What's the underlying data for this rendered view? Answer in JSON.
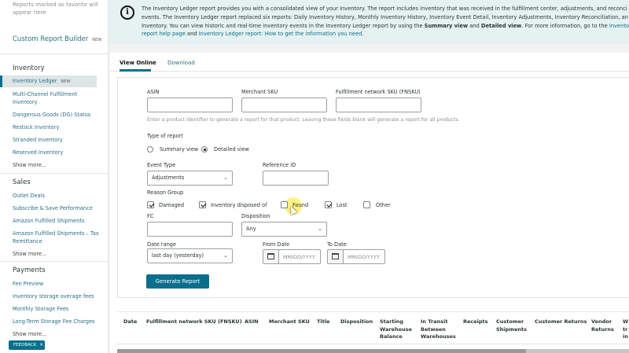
{
  "sidebar": {
    "favorites_hint": "Reports marked as favorite will appear here",
    "custom_builder": {
      "label": "Custom Report Builder",
      "tag": "NEW"
    },
    "inventory": {
      "heading": "Inventory",
      "items": [
        {
          "label": "Inventory Ledger",
          "tag": "NEW"
        },
        {
          "label": "Multi-Channel Fulfillment Inventory"
        },
        {
          "label": "Dangerous Goods (DG) Status"
        },
        {
          "label": "Restock Inventory"
        },
        {
          "label": "Stranded Inventory"
        },
        {
          "label": "Reserved Inventory"
        }
      ],
      "show_more": "Show more..."
    },
    "sales": {
      "heading": "Sales",
      "items": [
        {
          "label": "Outlet Deals"
        },
        {
          "label": "Subscribe & Save Performance"
        },
        {
          "label": "Amazon Fulfilled Shipments"
        },
        {
          "label": "Amazon Fulfilled Shipments – Tax Remittance"
        }
      ],
      "show_more": "Show more..."
    },
    "payments": {
      "heading": "Payments",
      "items": [
        {
          "label": "Fee Preview"
        },
        {
          "label": "Inventory storage overage fees"
        },
        {
          "label": "Monthly Storage Fees"
        },
        {
          "label": "Long-Term Storage Fee Charges"
        }
      ],
      "show_more": "Show more..."
    },
    "feedback": {
      "label": "FEEDBACK",
      "close": "×"
    }
  },
  "banner": {
    "line1": "The Inventory Ledger report provides you with a consolidated view of your inventory. The report includes inventory that was received in the fulfillment center, adjustments, and reconci",
    "line2": "events. The Inventory Ledger report replaced six reports: Daily Inventory History, Monthly Inventory History, Inventory Event Detail, Inventory Adjustments, Inventory Reconciliation, an",
    "line3_a": "Inventory. You can view historic and real-time inventory events in the Inventory Ledger report by using the ",
    "line3_b": "Summary view",
    "line3_c": " and ",
    "line3_d": "Detailed view",
    "line3_e": ". For more information, go to the ",
    "line3_f": "Inventory",
    "line4_a": "report help page",
    "line4_b": " and ",
    "line4_c": "Inventory Ledger report: How to get the information you need",
    "line4_d": "."
  },
  "tabs": [
    {
      "label": "View Online",
      "active": true
    },
    {
      "label": "Download",
      "active": false
    }
  ],
  "form": {
    "asin_label": "ASIN",
    "asin_value": "",
    "sku_label": "Merchant SKU",
    "sku_value": "",
    "fnsku_label": "Fulfillment network SKU (FNSKU)",
    "fnsku_value": "",
    "identifier_hint": "Enter a product identifier to generate a report for that product. Leaving these fields blank will generate a report for all products.",
    "report_type_label": "Type of report",
    "report_types": [
      {
        "label": "Summary view",
        "selected": false
      },
      {
        "label": "Detailed view",
        "selected": true
      }
    ],
    "event_type_label": "Event Type",
    "event_type_value": "Adjustments",
    "reference_id_label": "Reference ID",
    "reference_id_value": "",
    "reason_group_label": "Reason Group",
    "reasons": [
      {
        "label": "Damaged",
        "checked": true
      },
      {
        "label": "Inventory disposed of",
        "checked": true
      },
      {
        "label": "Found",
        "checked": false
      },
      {
        "label": "Lost",
        "checked": true
      },
      {
        "label": "Other",
        "checked": false
      }
    ],
    "fc_label": "FC",
    "fc_value": "",
    "disposition_label": "Disposition",
    "disposition_value": "Any",
    "date_range_label": "Date range",
    "date_range_value": "last day (yesterday)",
    "from_date_label": "From Date",
    "from_date_placeholder": "MM/DD/YYYY",
    "to_date_label": "To Date",
    "to_date_placeholder": "MM/DD/YYYY",
    "generate_label": "Generate Report"
  },
  "table": {
    "columns": [
      "Date",
      "Fulfillment network SKU (FNSKU)",
      "ASIN",
      "Merchant SKU",
      "Title",
      "Disposition",
      "Starting Warehouse Balance",
      "In Transit Between Warehouses",
      "Receipts",
      "Customer Shipments",
      "Customer Returns",
      "Vendor Returns",
      "W tr in"
    ]
  }
}
